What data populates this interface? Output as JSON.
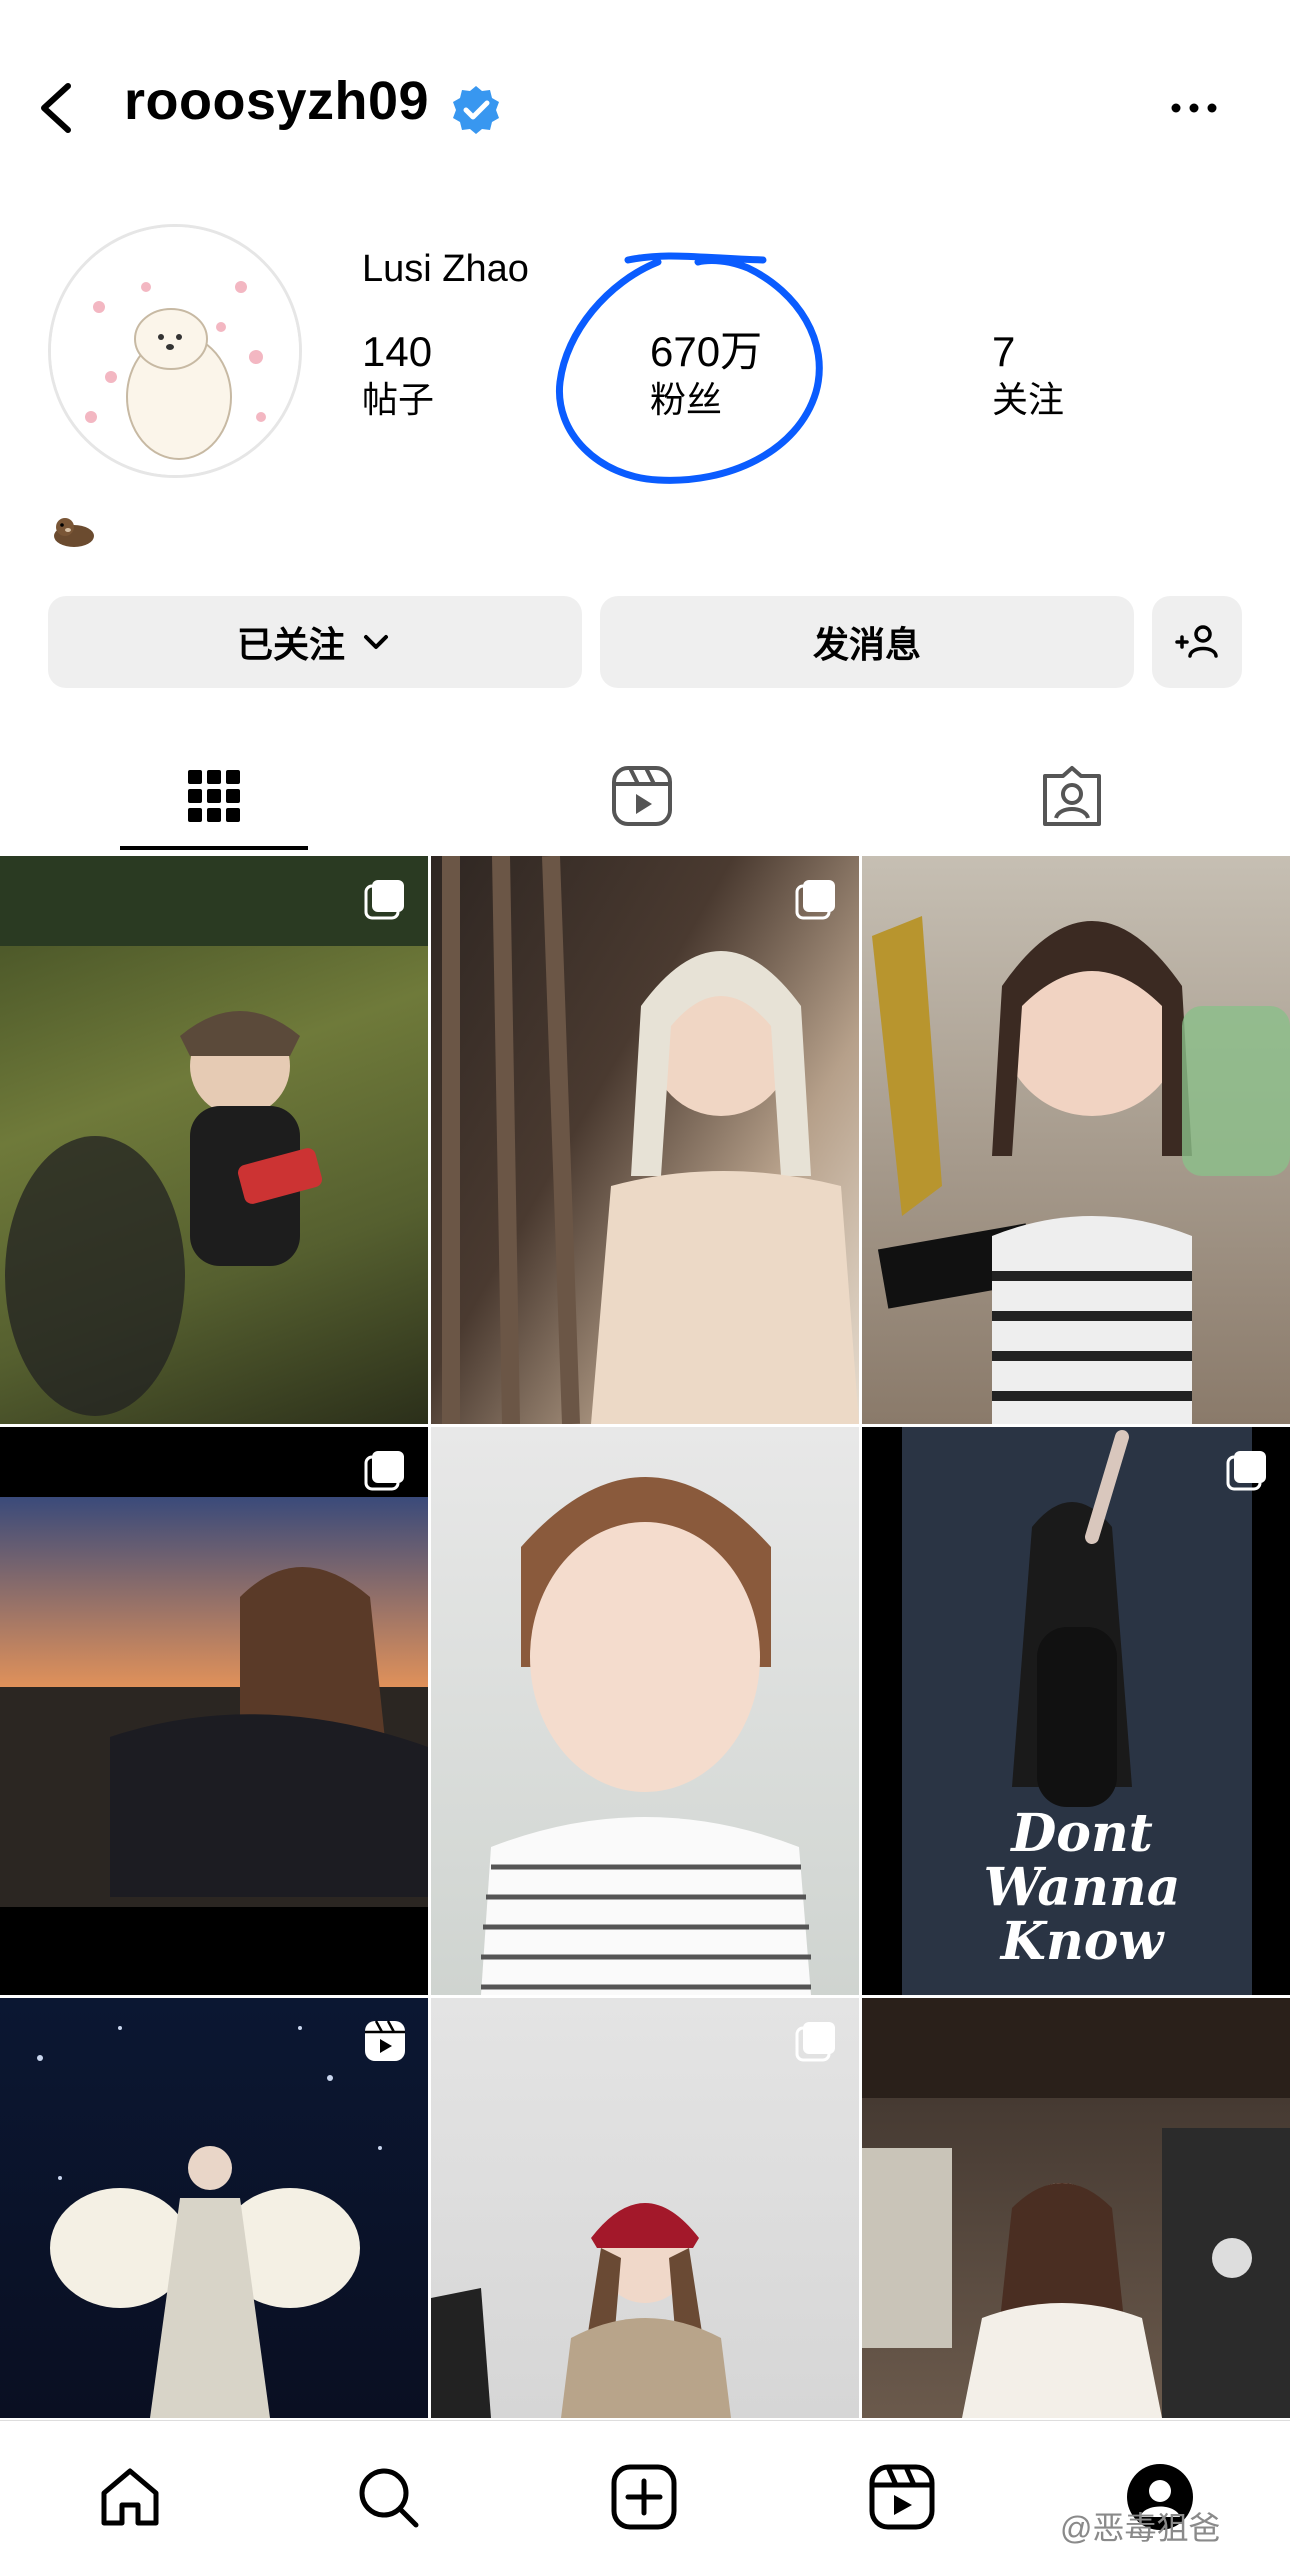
{
  "header": {
    "username": "rooosyzh09",
    "icons": {
      "back": "back-arrow-icon",
      "verified": "verified-badge-icon",
      "more": "more-dots-icon"
    }
  },
  "profile": {
    "full_name": "Lusi Zhao",
    "bio_emoji": "🦦",
    "stats": [
      {
        "value": "140",
        "label": "帖子"
      },
      {
        "value": "670万",
        "label": "粉丝"
      },
      {
        "value": "7",
        "label": "关注"
      }
    ]
  },
  "actions": {
    "following_label": "已关注",
    "message_label": "发消息",
    "add_user_icon": "add-user-icon"
  },
  "tabs": [
    {
      "name": "grid",
      "icon": "grid-icon",
      "selected": true
    },
    {
      "name": "reels",
      "icon": "reels-icon",
      "selected": false
    },
    {
      "name": "tagged",
      "icon": "tagged-icon",
      "selected": false
    }
  ],
  "posts": [
    {
      "badge": "carousel-icon",
      "text": ""
    },
    {
      "badge": "carousel-icon",
      "text": ""
    },
    {
      "badge": "",
      "text": ""
    },
    {
      "badge": "carousel-icon",
      "text": ""
    },
    {
      "badge": "",
      "text": ""
    },
    {
      "badge": "carousel-icon",
      "text": "Dont Wanna Know"
    },
    {
      "badge": "reels-icon",
      "text": ""
    },
    {
      "badge": "carousel-icon",
      "text": ""
    },
    {
      "badge": "",
      "text": ""
    }
  ],
  "bottom_nav": [
    "home-icon",
    "search-icon",
    "create-icon",
    "reels-icon",
    "profile-icon"
  ],
  "watermark": "@恶毒狙爸",
  "colors": {
    "accent_blue": "#0a5cff",
    "verified_blue": "#3897f0",
    "button_gray": "#efefef"
  }
}
